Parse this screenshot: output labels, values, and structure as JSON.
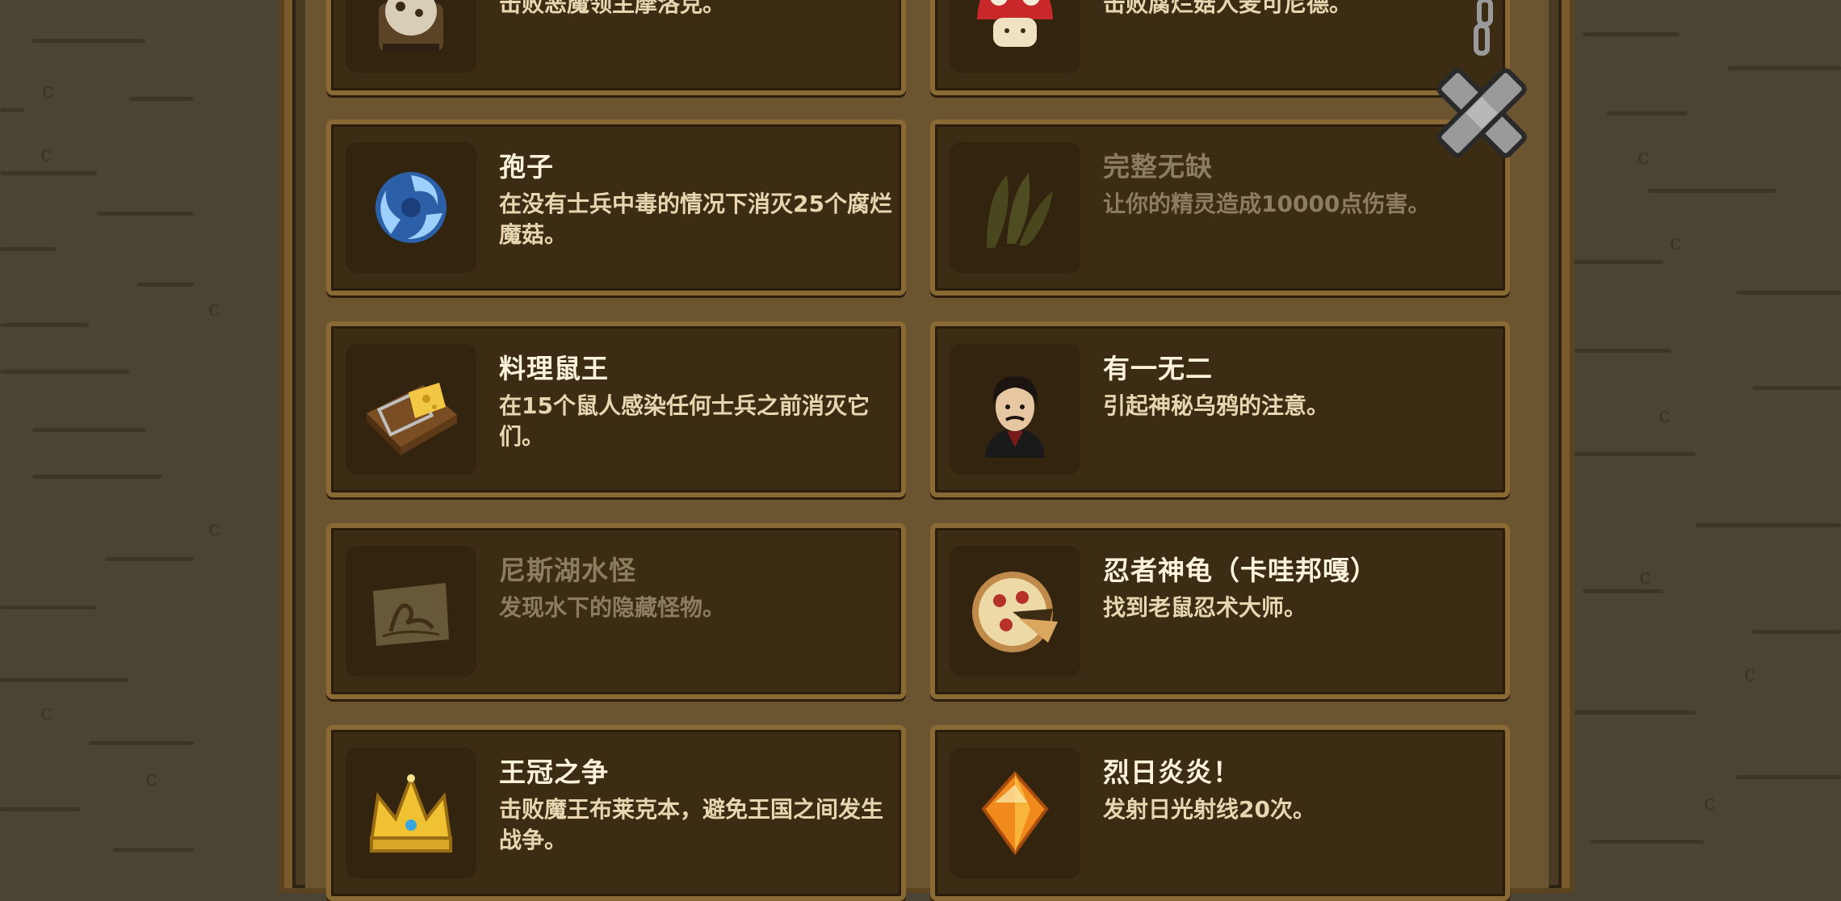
{
  "achievements": [
    {
      "title": "",
      "desc": "击败恶魔领主摩洛克。",
      "icon": "throne-icon",
      "locked": false
    },
    {
      "title": "",
      "desc": "击败腐烂菇人麦可尼德。",
      "icon": "mushroom-icon",
      "locked": false
    },
    {
      "title": "孢子",
      "desc": "在没有士兵中毒的情况下消灭25个腐烂魔菇。",
      "icon": "spore-swirl-icon",
      "locked": false
    },
    {
      "title": "完整无缺",
      "desc": "让你的精灵造成10000点伤害。",
      "icon": "elf-leaves-icon",
      "locked": true
    },
    {
      "title": "料理鼠王",
      "desc": "在15个鼠人感染任何士兵之前消灭它们。",
      "icon": "mousetrap-icon",
      "locked": false
    },
    {
      "title": "有一无二",
      "desc": "引起神秘乌鸦的注意。",
      "icon": "poet-portrait-icon",
      "locked": false
    },
    {
      "title": "尼斯湖水怪",
      "desc": "发现水下的隐藏怪物。",
      "icon": "monster-map-icon",
      "locked": true
    },
    {
      "title": "忍者神龟（卡哇邦嘎）",
      "desc": "找到老鼠忍术大师。",
      "icon": "pizza-icon",
      "locked": false
    },
    {
      "title": "王冠之争",
      "desc": "击败魔王布莱克本，避免王国之间发生战争。",
      "icon": "crown-icon",
      "locked": false
    },
    {
      "title": "烈日炎炎！",
      "desc": "发射日光射线20次。",
      "icon": "sun-crystal-icon",
      "locked": false
    }
  ],
  "close_button": {
    "icon": "close-x-icon"
  }
}
